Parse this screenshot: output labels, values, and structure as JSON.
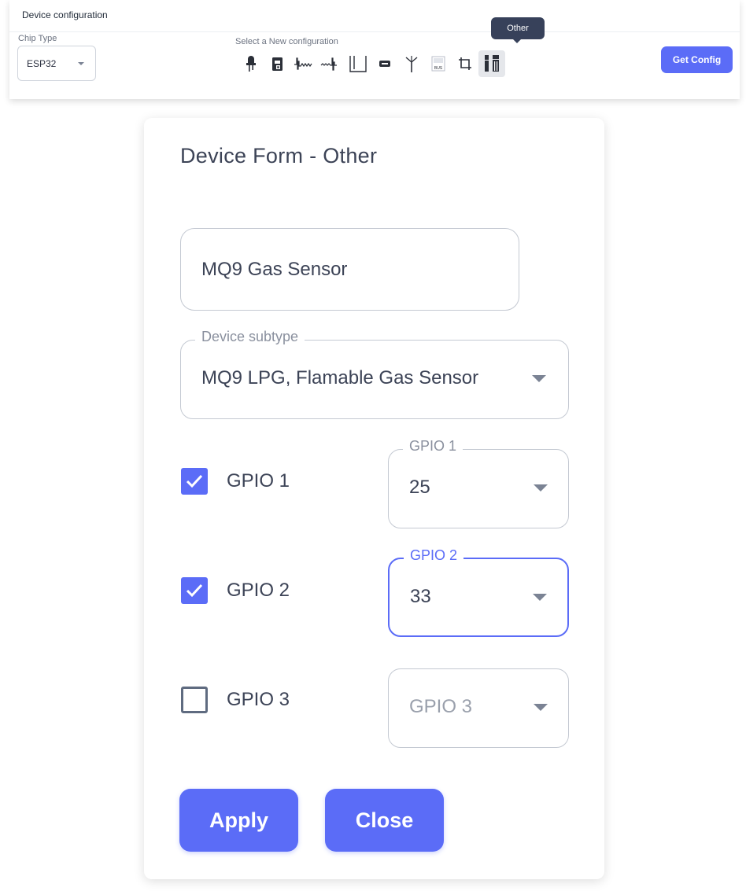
{
  "toolbar": {
    "title": "Device configuration",
    "chip_type_label": "Chip Type",
    "chip_type_value": "ESP32",
    "select_new_label": "Select a New configuration",
    "tooltip": "Other",
    "get_config_label": "Get Config",
    "icon_bus_text": "BUS",
    "config_icons": [
      {
        "name": "led-icon"
      },
      {
        "name": "relay-icon"
      },
      {
        "name": "pwm-wave-icon"
      },
      {
        "name": "analog-wave-icon"
      },
      {
        "name": "square-wave-icon"
      },
      {
        "name": "display-icon"
      },
      {
        "name": "antenna-icon"
      },
      {
        "name": "bus-icon"
      },
      {
        "name": "crop-icon"
      },
      {
        "name": "other-device-icon",
        "active": true
      }
    ]
  },
  "form": {
    "title": "Device Form - Other",
    "device_name": "MQ9 Gas Sensor",
    "subtype_label": "Device subtype",
    "subtype_value": "MQ9 LPG, Flamable Gas Sensor",
    "gpios": [
      {
        "label": "GPIO 1",
        "checked": true,
        "select_label": "GPIO 1",
        "value": "25",
        "focused": false
      },
      {
        "label": "GPIO 2",
        "checked": true,
        "select_label": "GPIO 2",
        "value": "33",
        "focused": true
      },
      {
        "label": "GPIO 3",
        "checked": false,
        "placeholder": "GPIO 3"
      }
    ],
    "apply_label": "Apply",
    "close_label": "Close"
  },
  "colors": {
    "accent": "#5b6cf7",
    "tooltip_bg": "#37415a",
    "text": "#3c4356",
    "border": "#c4c9d2"
  }
}
